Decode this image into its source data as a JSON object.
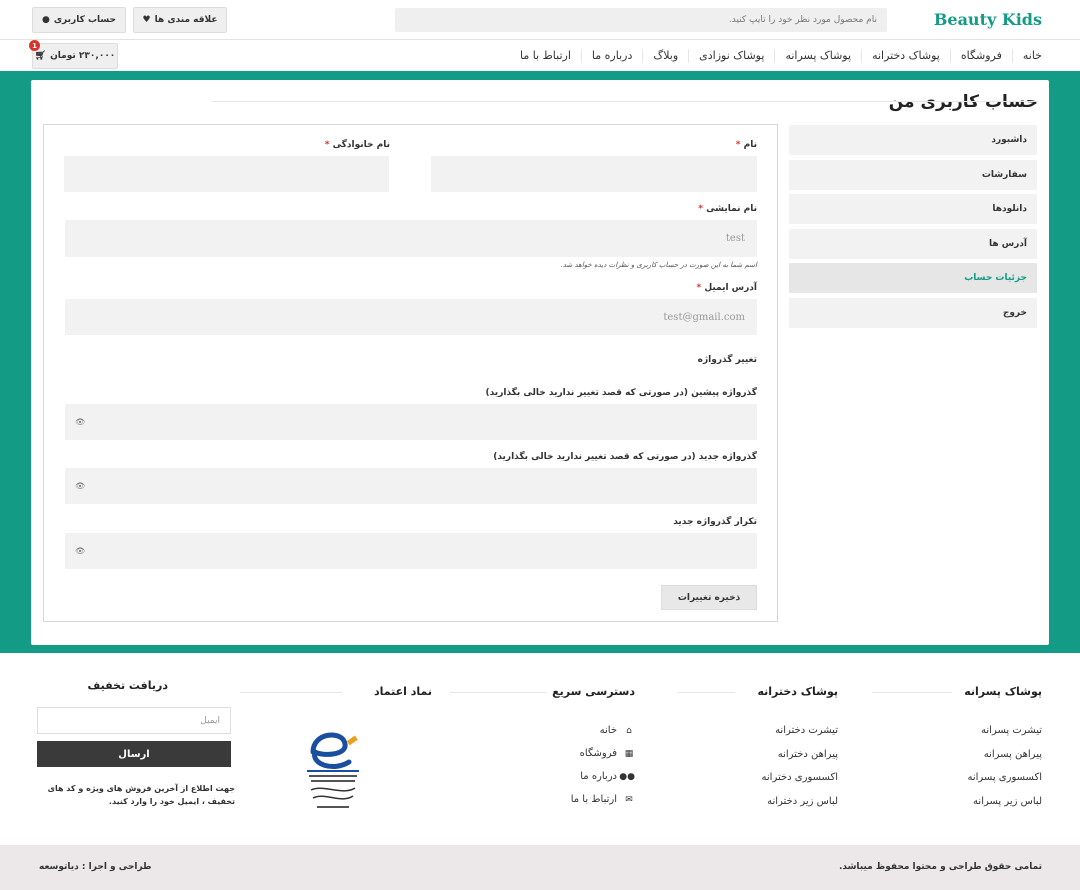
{
  "header": {
    "logo": "Beauty Kids",
    "search_placeholder": "نام محصول مورد نظر خود را تایپ کنید.",
    "wishlist_label": "علاقه مندی ها",
    "account_label": "حساب کاربری",
    "cart_total": "۲۳۰,۰۰۰ تومان",
    "cart_count": "1"
  },
  "nav": [
    "خانه",
    "فروشگاه",
    "پوشاک دخترانه",
    "پوشاک پسرانه",
    "پوشاک نوزادی",
    "وبلاگ",
    "درباره ما",
    "ارتباط با ما"
  ],
  "page": {
    "title": "حساب کاربری من"
  },
  "sidebar": {
    "items": [
      "داشبورد",
      "سفارشات",
      "دانلودها",
      "آدرس ها",
      "جزئیات حساب",
      "خروج"
    ],
    "active_index": 4
  },
  "form": {
    "first_name_label": "نام",
    "last_name_label": "نام خانوادگی",
    "display_name_label": "نام نمایشی",
    "display_name_value": "test",
    "display_name_hint": "اسم شما به این صورت در حساب کاربری و نظرات دیده خواهد شد.",
    "email_label": "آدرس ایمیل",
    "email_value": "test@gmail.com",
    "password_section": "تغییر گذرواژه",
    "current_password_label": "گذرواژه پیشین (در صورتی که قصد تغییر ندارید خالی بگذارید)",
    "new_password_label": "گذرواژه جدید (در صورتی که قصد تغییر ندارید خالی بگذارید)",
    "confirm_password_label": "تکرار گذرواژه جدید",
    "save_label": "ذخیره تغییرات",
    "required_mark": "*"
  },
  "footer": {
    "boys": {
      "title": "پوشاک پسرانه",
      "links": [
        "تیشرت پسرانه",
        "پیراهن پسرانه",
        "اکسسوری پسرانه",
        "لباس زیر پسرانه"
      ]
    },
    "girls": {
      "title": "پوشاک دخترانه",
      "links": [
        "تیشرت دخترانه",
        "پیراهن دخترانه",
        "اکسسوری دخترانه",
        "لباس زیر دخترانه"
      ]
    },
    "quick": {
      "title": "دسترسی سریع",
      "links": [
        "خانه",
        "فروشگاه",
        "درباره ما",
        "ارتباط با ما"
      ],
      "icons": [
        "home-icon",
        "store-icon",
        "users-icon",
        "envelope-icon"
      ]
    },
    "trust": {
      "title": "نماد اعتماد"
    },
    "newsletter": {
      "title": "دریافت تخفیف",
      "email_placeholder": "ایمیل",
      "send_label": "ارسال",
      "note": "جهت اطلاع از آخرین فروش های ویژه و کد های تخفیف ، ایمیل خود را وارد کنید."
    },
    "copyright": "تمامی حقوق طراحی و محتوا محفوظ میباشد.",
    "credit": "طراحی و اجرا : دیاتوسعه"
  },
  "colors": {
    "accent": "#139b86",
    "danger": "#d9342b"
  }
}
